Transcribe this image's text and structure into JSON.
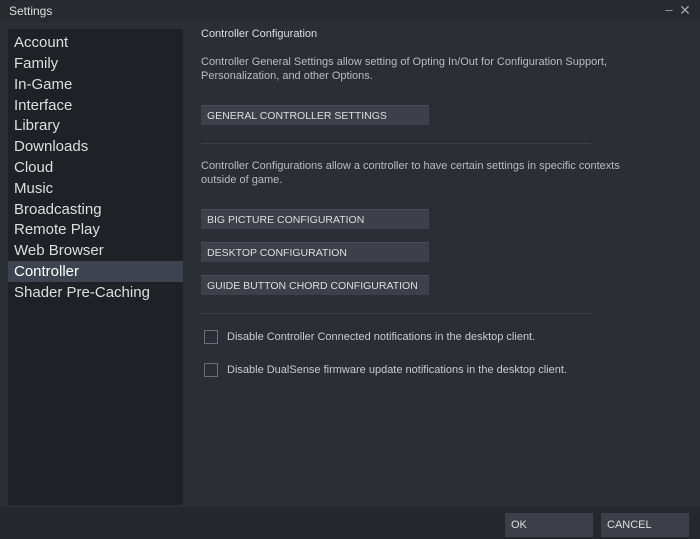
{
  "window": {
    "title": "Settings",
    "minimize_glyph": "–",
    "close_glyph": "✕"
  },
  "sidebar": {
    "items": [
      {
        "label": "Account"
      },
      {
        "label": "Family"
      },
      {
        "label": "In-Game"
      },
      {
        "label": "Interface"
      },
      {
        "label": "Library"
      },
      {
        "label": "Downloads"
      },
      {
        "label": "Cloud"
      },
      {
        "label": "Music"
      },
      {
        "label": "Broadcasting"
      },
      {
        "label": "Remote Play"
      },
      {
        "label": "Web Browser"
      },
      {
        "label": "Controller"
      },
      {
        "label": "Shader Pre-Caching"
      }
    ],
    "active": "Controller"
  },
  "main": {
    "title": "Controller Configuration",
    "general_desc": "Controller General Settings allow setting of Opting In/Out for Configuration Support, Personalization, and other Options.",
    "general_button": "GENERAL CONTROLLER SETTINGS",
    "config_desc": "Controller Configurations allow a controller to have certain settings in specific contexts outside of game.",
    "big_picture_button": "BIG PICTURE CONFIGURATION",
    "desktop_button": "DESKTOP CONFIGURATION",
    "guide_button": "GUIDE BUTTON CHORD CONFIGURATION",
    "checkboxes": [
      {
        "label": "Disable Controller Connected notifications in the desktop client.",
        "checked": false
      },
      {
        "label": "Disable DualSense firmware update notifications in the desktop client.",
        "checked": false
      }
    ]
  },
  "footer": {
    "ok": "OK",
    "cancel": "CANCEL"
  },
  "colors": {
    "background": "#2b2e34",
    "sidebar": "#1f2127",
    "active_item": "#3d4450",
    "button": "#3d4048"
  }
}
